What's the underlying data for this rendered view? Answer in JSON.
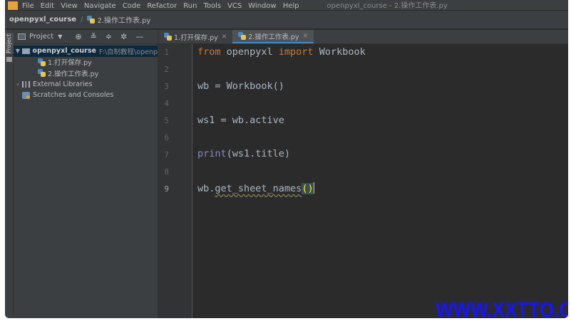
{
  "menubar": {
    "items": [
      "File",
      "Edit",
      "View",
      "Navigate",
      "Code",
      "Refactor",
      "Run",
      "Tools",
      "VCS",
      "Window",
      "Help"
    ],
    "window_title": "openpyxl_course - 2.操作工作表.py"
  },
  "breadcrumb": {
    "project": "openpyxl_course",
    "file": "2.操作工作表.py"
  },
  "left_strip": {
    "label": "Project"
  },
  "project_panel": {
    "title": "Project",
    "tree": {
      "root_name": "openpyxl_course",
      "root_path": "F:\\自制教程\\openp",
      "files": [
        "1.打开保存.py",
        "2.操作工作表.py"
      ],
      "external_libraries": "External Libraries",
      "scratches": "Scratches and Consoles"
    }
  },
  "tabs": [
    {
      "label": "1.打开保存.py",
      "active": false
    },
    {
      "label": "2.操作工作表.py",
      "active": true
    }
  ],
  "editor": {
    "current_line": 9,
    "line_numbers": [
      "1",
      "2",
      "3",
      "4",
      "5",
      "6",
      "7",
      "8",
      "9"
    ],
    "code": {
      "l1_kw_from": "from",
      "l1_module": " openpyxl ",
      "l1_kw_import": "import",
      "l1_name": " Workbook",
      "l3": "wb = Workbook()",
      "l5": "ws1 = wb.active",
      "l7_fn": "print",
      "l7_rest": "(ws1.title)",
      "l9_obj": "wb.",
      "l9_method": "get_sheet_names",
      "l9_parens": "()"
    }
  },
  "watermark": {
    "text": "WWW.XXTTQ.COM",
    "color": "#1515ff"
  },
  "colors": {
    "keyword": "#cc7832",
    "builtin": "#8888c6",
    "text": "#a9b7c6",
    "bg": "#2b2b2b"
  }
}
